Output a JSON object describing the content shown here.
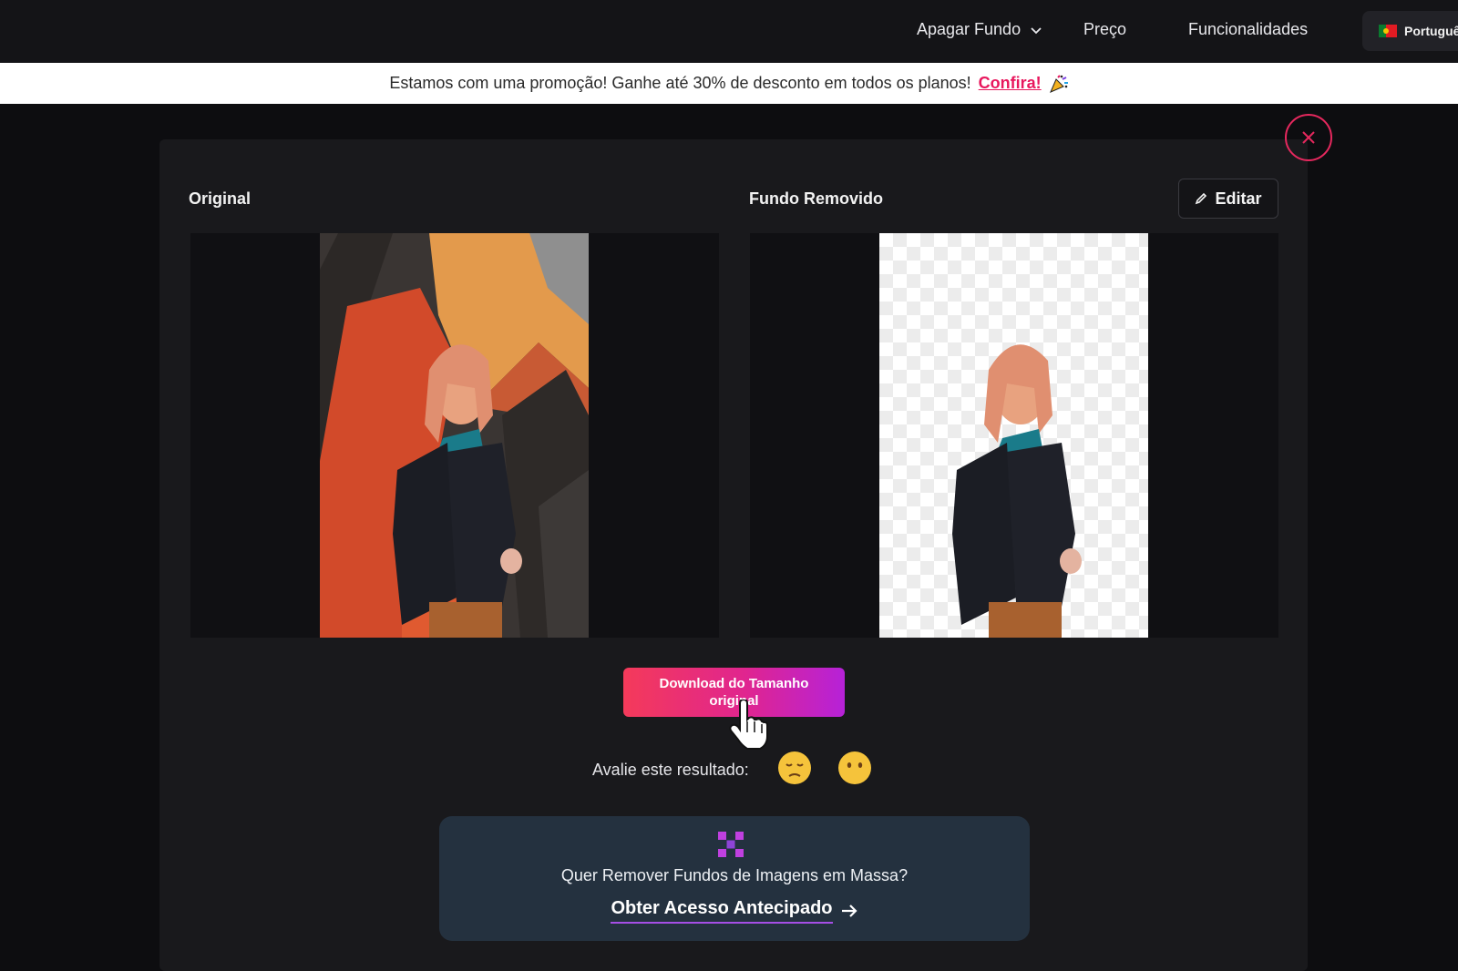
{
  "nav": {
    "items": [
      {
        "label": "Apagar Fundo",
        "has_dropdown": true
      },
      {
        "label": "Preço"
      },
      {
        "label": "Funcionalidades"
      }
    ],
    "language": "Portuguê"
  },
  "promo": {
    "text": "Estamos com uma promoção! Ganhe até 30% de desconto em todos os planos!",
    "link": "Confira!",
    "icon": "party-popper-icon"
  },
  "modal": {
    "original_title": "Original",
    "removed_title": "Fundo Removido",
    "edit_label": "Editar",
    "download_label": "Download do Tamanho original",
    "rating_label": "Avalie este resultado:",
    "bulk": {
      "text": "Quer Remover Fundos de Imagens em Massa?",
      "link": "Obter Acesso Antecipado",
      "icon": "grid-cross-icon"
    }
  },
  "colors": {
    "accent": "#e6285e",
    "gradient_start": "#f43a5a",
    "gradient_end": "#b622d8",
    "card_bg": "#24313f"
  }
}
